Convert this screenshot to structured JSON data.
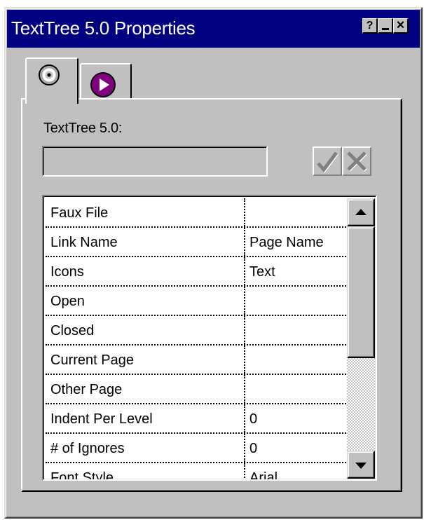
{
  "window": {
    "title": "TextTree 5.0 Properties",
    "help_button": "?",
    "close_button": "×"
  },
  "tabs": [
    {
      "icon": "disc-icon"
    },
    {
      "icon": "play-circle-icon"
    }
  ],
  "form": {
    "label": "TextTree 5.0:",
    "value": ""
  },
  "properties": [
    {
      "name": "Faux File",
      "value": ""
    },
    {
      "name": "Link Name",
      "value": "Page Name"
    },
    {
      "name": "Icons",
      "value": "Text"
    },
    {
      "name": "Open",
      "value": ""
    },
    {
      "name": "Closed",
      "value": ""
    },
    {
      "name": "Current Page",
      "value": ""
    },
    {
      "name": "Other Page",
      "value": ""
    },
    {
      "name": "Indent Per Level",
      "value": "0"
    },
    {
      "name": "# of Ignores",
      "value": "0"
    },
    {
      "name": "Font Style",
      "value": "Arial"
    }
  ],
  "colors": {
    "titlebar": "#000080",
    "face": "#c0c0c0",
    "play_icon": "#800080"
  }
}
